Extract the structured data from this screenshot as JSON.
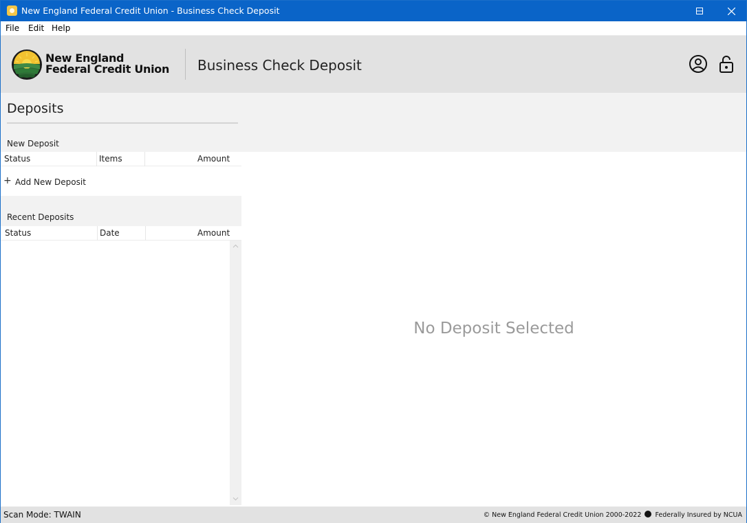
{
  "window": {
    "title": "New England Federal Credit Union - Business Check Deposit"
  },
  "menu": {
    "items": [
      {
        "label": "File"
      },
      {
        "label": "Edit"
      },
      {
        "label": "Help"
      }
    ]
  },
  "header": {
    "logo_line1": "New England",
    "logo_line2": "Federal Credit Union",
    "title": "Business Check Deposit",
    "icons": [
      "user-account-icon",
      "unlock-icon"
    ]
  },
  "deposits": {
    "title": "Deposits",
    "new_deposit": {
      "label": "New Deposit",
      "columns": [
        "Status",
        "Items",
        "",
        "Amount"
      ],
      "add_label": "Add New Deposit"
    },
    "recent_deposits": {
      "label": "Recent Deposits",
      "columns": [
        "Status",
        "Date",
        "",
        "Amount"
      ],
      "rows": []
    }
  },
  "detail": {
    "empty_message": "No Deposit Selected"
  },
  "status_bar": {
    "scan_mode": "Scan Mode: TWAIN",
    "copyright": "© New England Federal Credit Union 2000-2022",
    "insured": "Federally Insured by NCUA"
  },
  "colors": {
    "titlebar": "#0a64c8",
    "header_bg": "#e2e2e2",
    "panel_bg": "#f2f2f2",
    "empty_text": "#9a9a9a"
  }
}
